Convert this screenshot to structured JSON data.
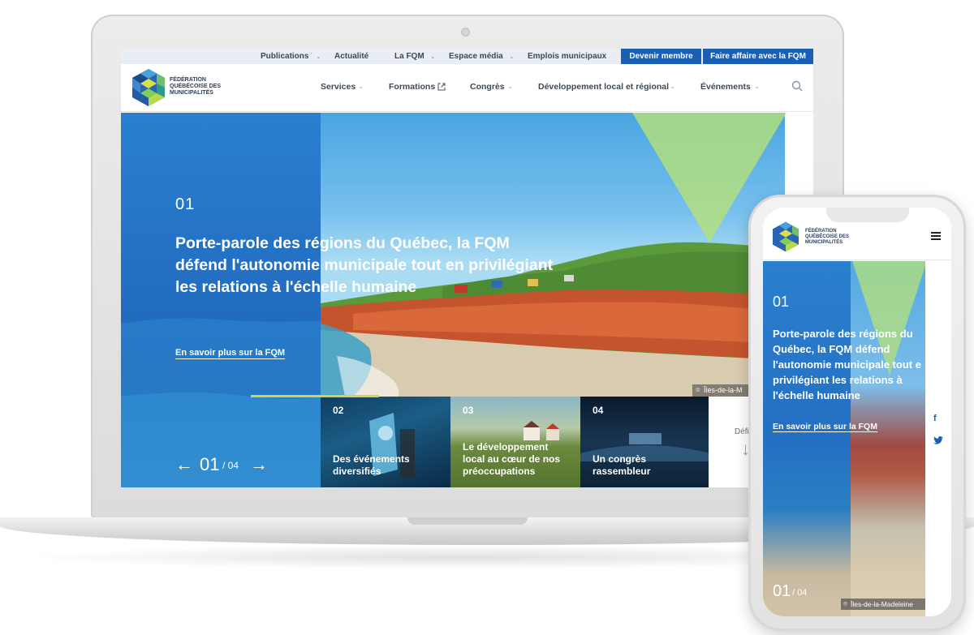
{
  "colors": {
    "brand_blue": "#1a5fb4",
    "hero_blue": "#236fc3",
    "accent_green": "#b5e178",
    "accent_yellow": "#d6d14b"
  },
  "topbar": {
    "links": [
      "Publications",
      "Actualité",
      "La FQM",
      "Espace média",
      "Emplois municipaux"
    ],
    "cta_member": "Devenir membre",
    "cta_business": "Faire affaire avec la FQM"
  },
  "logo": {
    "line1": "FÉDÉRATION",
    "line2": "QUÉBÉCOISE DES",
    "line3": "MUNICIPALITÉS"
  },
  "nav": {
    "items": [
      "Services",
      "Formations",
      "Congrès",
      "Développement local et régional",
      "Événements"
    ],
    "search_icon": "search-icon"
  },
  "hero": {
    "number": "01",
    "title": "Porte-parole des régions du Québec, la FQM défend l'autonomie municipale tout en privilégiant les relations à l'échelle humaine",
    "link": "En savoir plus sur la FQM",
    "location": "Îles-de-la-M",
    "pager_current": "01",
    "pager_total": "/ 04",
    "prev_arrow": "←",
    "next_arrow": "→"
  },
  "slides": [
    {
      "num": "02",
      "text": "Des événements diversifiés"
    },
    {
      "num": "03",
      "text": "Le développement local au cœur de nos préoccupations"
    },
    {
      "num": "04",
      "text": "Un congrès rassembleur"
    }
  ],
  "scroll_hint": {
    "text": "Défi",
    "arrow": "↓"
  },
  "mobile": {
    "number": "01",
    "title": "Porte-parole des régions du Québec, la FQM défend l'autonomie municipale tout e privilégiant les relations à l'échelle humaine",
    "link": "En savoir plus sur la FQM",
    "pager_current": "01",
    "pager_total": "/ 04",
    "location": "Îles-de-la-Madeleine",
    "facebook": "f",
    "twitter": "t"
  }
}
